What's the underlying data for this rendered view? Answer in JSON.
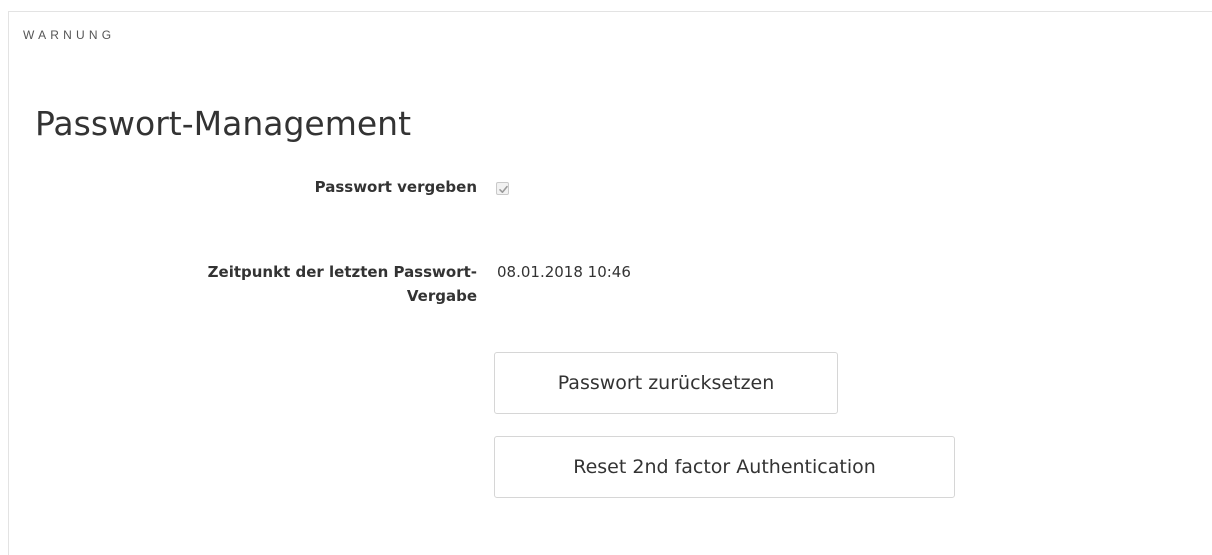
{
  "header": {
    "warning_label": "WARNUNG"
  },
  "section": {
    "title": "Passwort-Management"
  },
  "fields": {
    "password_set": {
      "label": "Passwort vergeben",
      "checked": true
    },
    "last_password_time": {
      "label_line1": "Zeitpunkt der letzten Passwort-",
      "label_line2": "Vergabe",
      "value": "08.01.2018 10:46"
    }
  },
  "buttons": {
    "reset_password": "Passwort zurücksetzen",
    "reset_2fa": "Reset 2nd factor Authentication"
  },
  "icons": {
    "checkbox_check": "check-icon"
  }
}
